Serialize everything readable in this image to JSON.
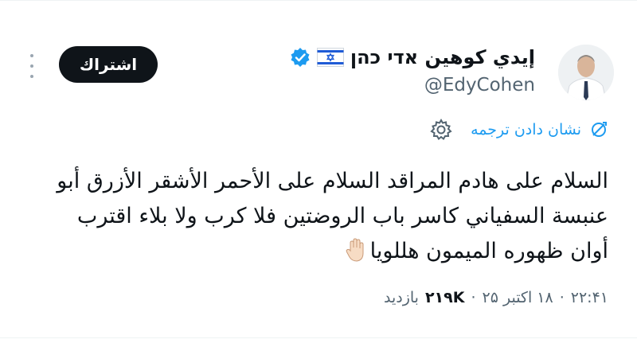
{
  "author": {
    "display_name": "إيدي كوهين אדי כהן",
    "handle": "@EdyCohen",
    "flag_icon": "israel-flag-icon",
    "verified_icon": "verified-badge-icon",
    "verified_color": "#1d9bf0"
  },
  "actions": {
    "subscribe_label": "اشتراك",
    "more_icon": "more-vertical-icon"
  },
  "translate": {
    "label": "نشان دادن ترجمه",
    "icon": "globe-icon",
    "settings_icon": "gear-icon"
  },
  "tweet": {
    "lines": [
      "السلام على هادم المراقد السلام على الأحمر الأشقر الأزرق أبو",
      "عنبسة السفياني كاسر باب الروضتين فلا كرب ولا بلاء اقترب",
      "أوان ظهوره الميمون هللويا"
    ],
    "emoji_icon": "raised-hand-icon"
  },
  "meta": {
    "time": "۲۲:۴۱",
    "date": "۱۸ اکتبر ۲۵",
    "views_count": "۲۱۹K",
    "views_label": "بازدید",
    "separator": "·"
  },
  "colors": {
    "link": "#1d9bf0",
    "text": "#0f1419",
    "muted": "#536471",
    "button_bg": "#0f1419"
  }
}
